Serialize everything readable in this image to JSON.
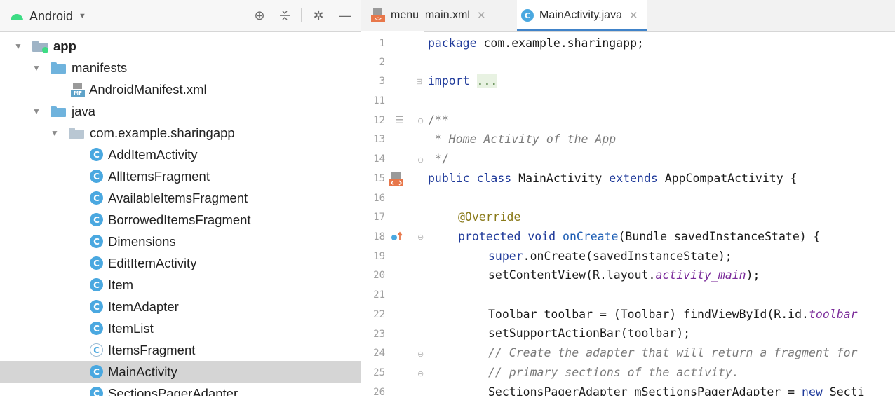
{
  "project_panel": {
    "view_selector": "Android",
    "tree": [
      {
        "label": "app",
        "bold": true,
        "type": "module"
      },
      {
        "label": "manifests",
        "type": "folder"
      },
      {
        "label": "AndroidManifest.xml",
        "type": "manifest"
      },
      {
        "label": "java",
        "type": "folder"
      },
      {
        "label": "com.example.sharingapp",
        "type": "package"
      },
      {
        "label": "AddItemActivity",
        "type": "class"
      },
      {
        "label": "AllItemsFragment",
        "type": "class"
      },
      {
        "label": "AvailableItemsFragment",
        "type": "class"
      },
      {
        "label": "BorrowedItemsFragment",
        "type": "class"
      },
      {
        "label": "Dimensions",
        "type": "class"
      },
      {
        "label": "EditItemActivity",
        "type": "class"
      },
      {
        "label": "Item",
        "type": "class"
      },
      {
        "label": "ItemAdapter",
        "type": "class"
      },
      {
        "label": "ItemList",
        "type": "class"
      },
      {
        "label": "ItemsFragment",
        "type": "abstract-class"
      },
      {
        "label": "MainActivity",
        "type": "class",
        "selected": true
      },
      {
        "label": "SectionsPagerAdapter",
        "type": "class"
      }
    ]
  },
  "editor": {
    "tabs": [
      {
        "label": "menu_main.xml",
        "active": false
      },
      {
        "label": "MainActivity.java",
        "active": true
      }
    ],
    "line_numbers": [
      "1",
      "2",
      "3",
      "11",
      "12",
      "13",
      "14",
      "15",
      "16",
      "17",
      "18",
      "19",
      "20",
      "21",
      "22",
      "23",
      "24",
      "25",
      "26"
    ],
    "code": {
      "l1_kw": "package",
      "l1_rest": " com.example.sharingapp;",
      "l3_kw": "import",
      "l3_fold": "...",
      "l12": "/**",
      "l13": " * Home Activity of the App",
      "l14": " */",
      "l15_kw1": "public class",
      "l15_name": " MainActivity ",
      "l15_kw2": "extends",
      "l15_rest": " AppCompatActivity {",
      "l17": "@Override",
      "l18_kw": "protected void",
      "l18_meth": " onCreate",
      "l18_rest": "(Bundle savedInstanceState) {",
      "l19_kw": "super",
      "l19_rest": ".onCreate(savedInstanceState);",
      "l20_a": "setContentView(R.layout.",
      "l20_fld": "activity_main",
      "l20_b": ");",
      "l22_a": "Toolbar toolbar = (Toolbar) findViewById(R.id.",
      "l22_fld": "toolbar",
      "l23": "setSupportActionBar(toolbar);",
      "l24": "// Create the adapter that will return a fragment for",
      "l25": "// primary sections of the activity.",
      "l26_a": "SectionsPagerAdapter mSectionsPagerAdapter = ",
      "l26_kw": "new",
      "l26_b": " Secti"
    }
  },
  "colors": {
    "keyword": "#1f3a9a",
    "comment": "#7b7b7b",
    "annotation": "#8a7a1a",
    "field": "#7b2c9a",
    "selection": "#d5d5d5",
    "class_icon": "#4aa8e0",
    "android_green": "#3ddc84"
  },
  "icons": [
    "android-icon",
    "target-icon",
    "collapse-icon",
    "gear-icon",
    "minimize-icon",
    "folder-icon",
    "class-icon",
    "xml-icon",
    "override-icon"
  ]
}
